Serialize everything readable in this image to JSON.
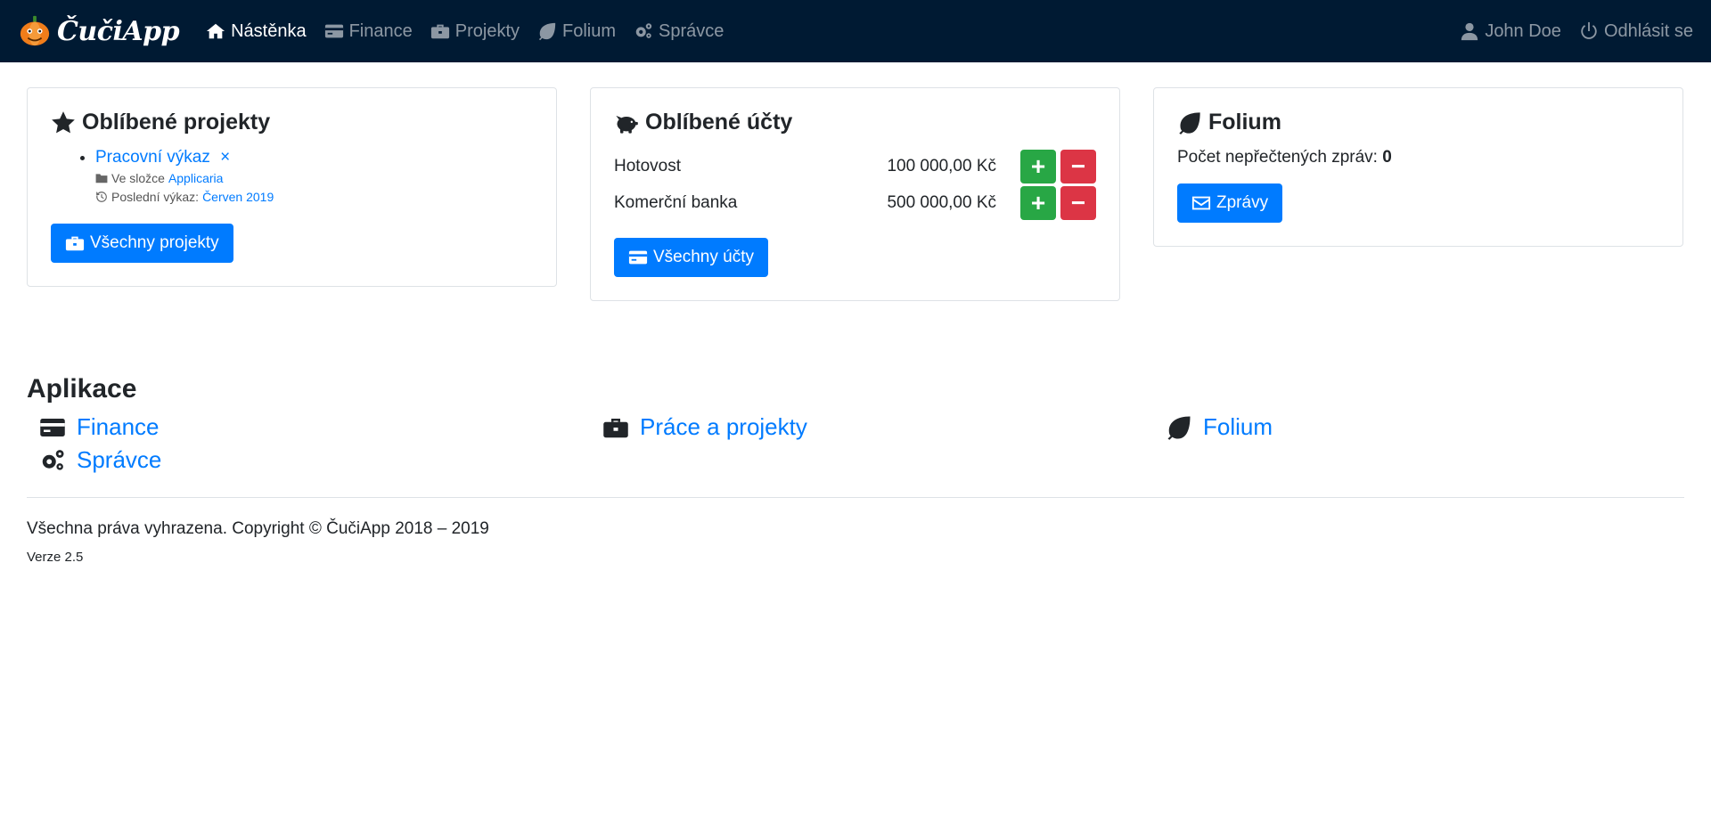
{
  "brand": {
    "name": "ČučiApp"
  },
  "nav": {
    "items": [
      {
        "label": "Nástěnka",
        "icon": "home-icon",
        "active": true
      },
      {
        "label": "Finance",
        "icon": "credit-card-icon"
      },
      {
        "label": "Projekty",
        "icon": "briefcase-icon"
      },
      {
        "label": "Folium",
        "icon": "leaf-icon"
      },
      {
        "label": "Správce",
        "icon": "cogs-icon"
      }
    ],
    "user": "John Doe",
    "logout": "Odhlásit se"
  },
  "fav_projects": {
    "title": "Oblíbené projekty",
    "items": [
      {
        "name": "Pracovní výkaz",
        "remove": "×",
        "folder_label": "Ve složce",
        "folder_link": "Applicaria",
        "last_label": "Poslední výkaz:",
        "last_link": "Červen 2019"
      }
    ],
    "button": "Všechny projekty"
  },
  "fav_accounts": {
    "title": "Oblíbené účty",
    "rows": [
      {
        "name": "Hotovost",
        "amount": "100 000,00 Kč"
      },
      {
        "name": "Komerční banka",
        "amount": "500 000,00 Kč"
      }
    ],
    "plus": "+",
    "minus": "−",
    "button": "Všechny účty"
  },
  "folium": {
    "title": "Folium",
    "unread_label": "Počet nepřečtených zpráv:",
    "unread_count": "0",
    "button": "Zprávy"
  },
  "apps": {
    "title": "Aplikace",
    "items": [
      {
        "label": "Finance",
        "icon": "credit-card-icon"
      },
      {
        "label": "Práce a projekty",
        "icon": "briefcase-icon"
      },
      {
        "label": "Folium",
        "icon": "leaf-icon"
      },
      {
        "label": "Správce",
        "icon": "cogs-icon"
      }
    ]
  },
  "footer": {
    "copyright": "Všechna práva vyhrazena. Copyright © ČučiApp 2018 – 2019",
    "version": "Verze 2.5"
  },
  "colors": {
    "navbar": "#001a33",
    "primary": "#007bff",
    "success": "#28a745",
    "danger": "#dc3545"
  }
}
